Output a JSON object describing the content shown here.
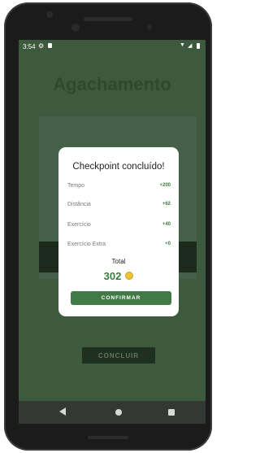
{
  "status_bar": {
    "time": "3:54"
  },
  "screen": {
    "title": "Agachamento",
    "conclude_button": "CONCLUIR"
  },
  "dialog": {
    "title": "Checkpoint concluído!",
    "rows": [
      {
        "label": "Tempo",
        "value": "+200"
      },
      {
        "label": "Distância",
        "value": "+62"
      },
      {
        "label": "Exercício",
        "value": "+40"
      },
      {
        "label": "Exercício Extra",
        "value": "+0"
      }
    ],
    "total_label": "Total",
    "total_value": "302",
    "confirm_label": "CONFIRMAR"
  },
  "icons": {
    "status": [
      "gear-icon",
      "sd-card-icon",
      "wifi-icon",
      "signal-icon",
      "battery-icon"
    ],
    "nav": [
      "back-icon",
      "home-icon",
      "recents-icon"
    ],
    "coin": "coin-icon"
  },
  "colors": {
    "accent": "#417a46",
    "points": "#3b7a3b",
    "title_green": "#2d4a2d",
    "overlay_bg": "#3e5a3e",
    "coin": "#f1c232"
  }
}
